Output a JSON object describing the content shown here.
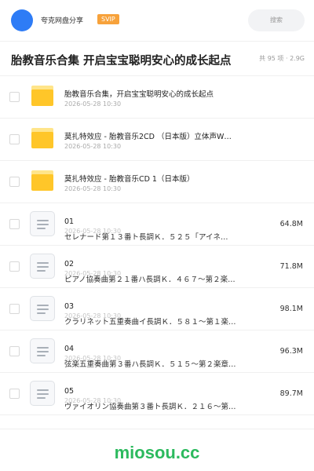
{
  "header": {
    "brand": "夸克网盘分享",
    "badge": "SVIP",
    "search_placeholder": "搜索"
  },
  "share": {
    "title": "胎教音乐合集 开启宝宝聪明安心的成长起点",
    "meta": "共 95 项 · 2.9G"
  },
  "folders": [
    {
      "name": "胎教音乐合集，开启宝宝聪明安心的成长起点",
      "date": "2026-05-28 10:30"
    },
    {
      "name": "莫扎特效应 - 胎教音乐2CD （日本版）立体声W…",
      "date": "2026-05-28 10:30"
    },
    {
      "name": "莫扎特效应 - 胎教音乐CD 1（日本版）",
      "date": "2026-05-28 10:30"
    }
  ],
  "files": [
    {
      "num": "01",
      "date": "2026-05-28 10:30",
      "title": "セレナード第１３番ト長調Ｋ．５２５「アイネ…",
      "size": "64.8M"
    },
    {
      "num": "02",
      "date": "2026-05-28 10:30",
      "title": "ピアノ協奏曲第２１番ハ長調Ｋ．４６７～第２楽…",
      "size": "71.8M"
    },
    {
      "num": "03",
      "date": "2026-05-28 10:30",
      "title": "クラリネット五重奏曲イ長調Ｋ．５８１～第１楽…",
      "size": "98.1M"
    },
    {
      "num": "04",
      "date": "2026-05-28 10:30",
      "title": "弦楽五重奏曲第３番ハ長調Ｋ．５１５～第２楽章…",
      "size": "96.3M"
    },
    {
      "num": "05",
      "date": "2026-05-28 10:30",
      "title": "ヴァイオリン協奏曲第３番ト長調Ｋ．２１６～第…",
      "size": "89.7M"
    }
  ],
  "footer": {
    "brand": "miosou.cc"
  },
  "colors": {
    "accent": "#2e7cf6",
    "svip": "#f7a23b",
    "folder": "#ffc629",
    "footer_brand": "#2cba5e"
  },
  "icons": {
    "folder": "folder-icon",
    "file": "document-icon",
    "checkbox": "checkbox"
  }
}
